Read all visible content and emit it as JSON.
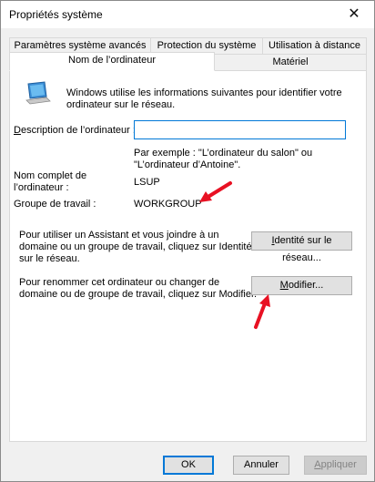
{
  "window": {
    "title": "Propriétés système",
    "close": "✕"
  },
  "tabs": {
    "row1": [
      "Paramètres système avancés",
      "Protection du système",
      "Utilisation à distance"
    ],
    "row2": [
      "Nom de l’ordinateur",
      "Matériel"
    ]
  },
  "panel": {
    "intro_line1": "Windows utilise les informations suivantes pour identifier votre",
    "intro_line2": "ordinateur sur le réseau.",
    "description_label_u": "D",
    "description_label_rest": "escription de l’ordinateur :",
    "description_value": "",
    "example_line1": "Par exemple : \"L’ordinateur du salon\" ou",
    "example_line2": "\"L’ordinateur d’Antoine\".",
    "fullname_label_line1": "Nom complet de",
    "fullname_label_line2": "l’ordinateur :",
    "fullname_value": "LSUP",
    "workgroup_label": "Groupe de travail :",
    "workgroup_value": "WORKGROUP",
    "network_text_line1": "Pour utiliser un Assistant et vous joindre à un",
    "network_text_line2": "domaine ou un groupe de travail, cliquez sur Identité",
    "network_text_line3": "sur le réseau.",
    "network_button_u": "I",
    "network_button_rest": "dentité sur le réseau...",
    "rename_text_line1": "Pour renommer cet ordinateur ou changer de",
    "rename_text_line2": "domaine ou de groupe de travail, cliquez sur Modifier.",
    "modify_button_u": "M",
    "modify_button_rest": "odifier..."
  },
  "footer": {
    "ok": "OK",
    "cancel": "Annuler",
    "apply_u": "A",
    "apply_rest": "ppliquer"
  },
  "colors": {
    "annotation_arrow": "#e81123",
    "focus": "#0078d7"
  },
  "icons": [
    "computer-icon",
    "red-arrow-annotation"
  ]
}
